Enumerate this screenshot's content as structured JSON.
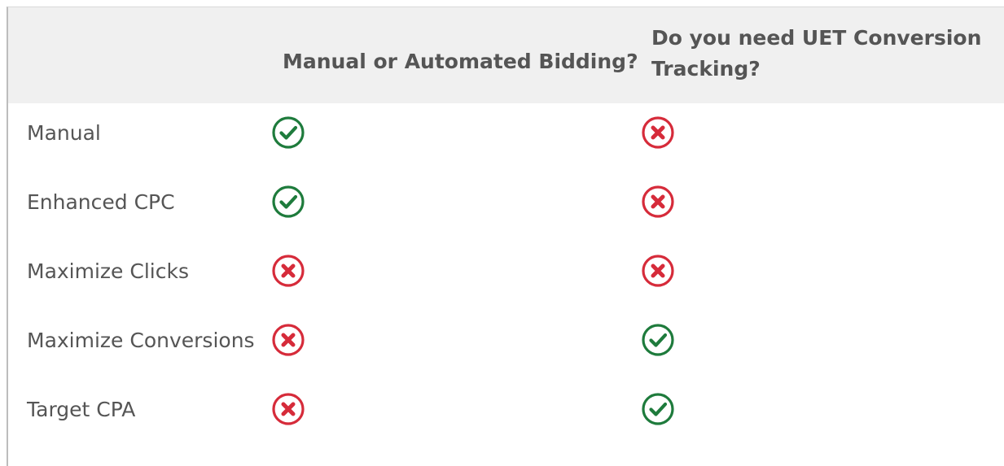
{
  "table": {
    "headers": {
      "blank": "",
      "col1": "Manual or Automated Bidding?",
      "col2": "Do you need UET Conversion Tracking?"
    },
    "rows": [
      {
        "label": "Manual",
        "col1": "check",
        "col2": "cross"
      },
      {
        "label": "Enhanced CPC",
        "col1": "check",
        "col2": "cross"
      },
      {
        "label": "Maximize Clicks",
        "col1": "cross",
        "col2": "cross"
      },
      {
        "label": "Maximize Conversions",
        "col1": "cross",
        "col2": "check"
      },
      {
        "label": "Target CPA",
        "col1": "cross",
        "col2": "check"
      }
    ]
  },
  "icons": {
    "check": "check-circle-icon",
    "cross": "x-circle-icon"
  },
  "colors": {
    "check": "#1e7b3c",
    "cross": "#d62b3a",
    "header_bg": "#f0f0f0",
    "text": "#555555"
  }
}
